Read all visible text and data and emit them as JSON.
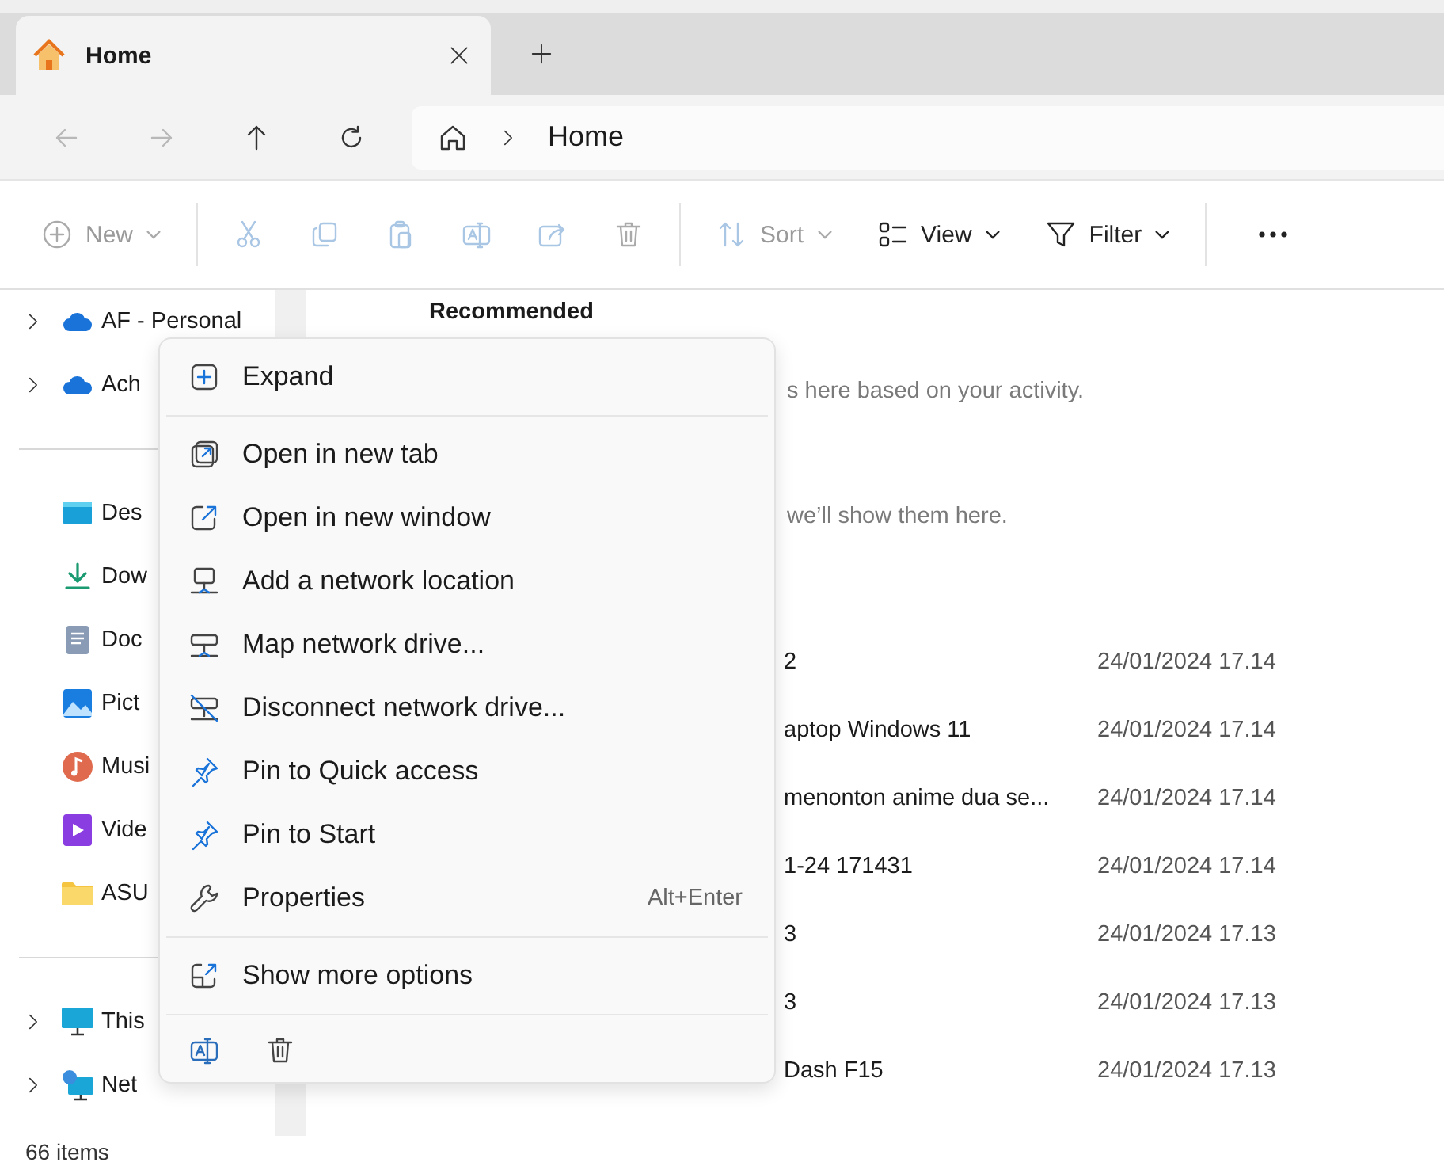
{
  "tabs": [
    {
      "title": "Home",
      "selected": true
    }
  ],
  "nav": [
    {
      "kind": "back",
      "disabled": true
    },
    {
      "kind": "forward",
      "disabled": true
    },
    {
      "kind": "up",
      "disabled": false
    },
    {
      "kind": "refresh",
      "disabled": false
    }
  ],
  "address": {
    "crumbs": [
      "Home"
    ]
  },
  "toolbar": [
    {
      "kind": "new",
      "label": "New",
      "disabled": true,
      "dropdown": true
    },
    {
      "kind": "sep"
    },
    {
      "kind": "cut",
      "disabled": true
    },
    {
      "kind": "copy",
      "disabled": true
    },
    {
      "kind": "paste",
      "disabled": true
    },
    {
      "kind": "rename",
      "disabled": true
    },
    {
      "kind": "share",
      "disabled": true
    },
    {
      "kind": "delete",
      "disabled": true
    },
    {
      "kind": "sep"
    },
    {
      "kind": "sort",
      "label": "Sort",
      "disabled": true,
      "dropdown": true
    },
    {
      "kind": "view",
      "label": "View",
      "disabled": false,
      "dropdown": true
    },
    {
      "kind": "filter",
      "label": "Filter",
      "disabled": false,
      "dropdown": true
    },
    {
      "kind": "sep"
    },
    {
      "kind": "more"
    }
  ],
  "sidebar": {
    "groups": [
      [
        {
          "label": "AF - Personal",
          "kind": "cloud",
          "expandable": true
        },
        {
          "label": "Ach",
          "kind": "cloud",
          "expandable": true
        }
      ],
      [
        {
          "label": "Des",
          "kind": "desktop",
          "expandable": false
        },
        {
          "label": "Dow",
          "kind": "download",
          "expandable": false
        },
        {
          "label": "Doc",
          "kind": "document",
          "expandable": false
        },
        {
          "label": "Pict",
          "kind": "pictures",
          "expandable": false
        },
        {
          "label": "Musi",
          "kind": "music",
          "expandable": false
        },
        {
          "label": "Vide",
          "kind": "video",
          "expandable": false
        },
        {
          "label": "ASU",
          "kind": "folder",
          "expandable": false
        }
      ],
      [
        {
          "label": "This",
          "kind": "pc",
          "expandable": true
        },
        {
          "label": "Net",
          "kind": "network",
          "expandable": true
        }
      ]
    ]
  },
  "main": {
    "section_title": "Recommended",
    "messages": [
      "s here based on your activity.",
      "we’ll show them here."
    ],
    "rows": [
      {
        "name": "2",
        "date": "24/01/2024 17.14"
      },
      {
        "name": "aptop Windows 11",
        "date": "24/01/2024 17.14"
      },
      {
        "name": "menonton anime dua se...",
        "date": "24/01/2024 17.14"
      },
      {
        "name": "1-24 171431",
        "date": "24/01/2024 17.14"
      },
      {
        "name": "3",
        "date": "24/01/2024 17.13"
      },
      {
        "name": "3",
        "date": "24/01/2024 17.13"
      },
      {
        "name": "Dash F15",
        "date": "24/01/2024 17.13"
      }
    ]
  },
  "context_menu": {
    "sections": [
      [
        {
          "label": "Expand",
          "kind": "expand"
        }
      ],
      [
        {
          "label": "Open in new tab",
          "kind": "newtab"
        },
        {
          "label": "Open in new window",
          "kind": "newwindow"
        },
        {
          "label": "Add a network location",
          "kind": "netloc"
        },
        {
          "label": "Map network drive...",
          "kind": "netdrive"
        },
        {
          "label": "Disconnect network drive...",
          "kind": "netdisconnect"
        },
        {
          "label": "Pin to Quick access",
          "kind": "pin"
        },
        {
          "label": "Pin to Start",
          "kind": "pin"
        },
        {
          "label": "Properties",
          "kind": "wrench",
          "shortcut": "Alt+Enter"
        }
      ],
      [
        {
          "label": "Show more options",
          "kind": "more-options"
        }
      ]
    ],
    "actions": [
      {
        "kind": "rename"
      },
      {
        "kind": "delete"
      }
    ]
  },
  "status_bar": {
    "count": "66 items"
  }
}
